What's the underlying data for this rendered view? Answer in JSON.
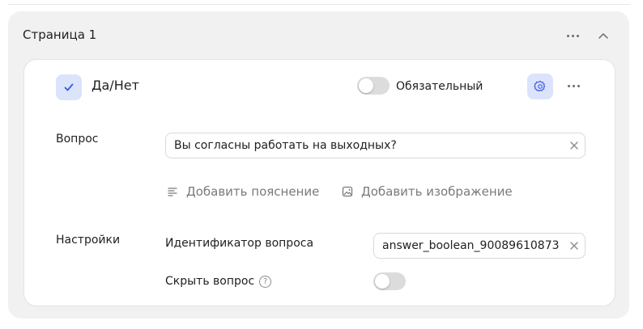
{
  "page": {
    "title": "Страница 1"
  },
  "question": {
    "type_label": "Да/Нет",
    "required_label": "Обязательный",
    "required_on": false,
    "text_label": "Вопрос",
    "text_value": "Вы согласны работать на выходных?",
    "add_hint_label": "Добавить пояснение",
    "add_image_label": "Добавить изображение"
  },
  "settings": {
    "label": "Настройки",
    "id_label": "Идентификатор вопроса",
    "id_value": "answer_boolean_90089610873",
    "hide_label": "Скрыть вопрос",
    "hide_help": "?",
    "hide_on": false
  },
  "colors": {
    "accent": "#3b5bdb",
    "accent_bg": "#dbe4fb",
    "panel_bg": "#f1f1f1",
    "toggle_off": "#dcdcdc"
  },
  "icons": [
    "more-icon",
    "chevron-up-icon",
    "check-icon",
    "gear-icon",
    "close-icon",
    "text-lines-icon",
    "image-icon",
    "help-icon"
  ]
}
